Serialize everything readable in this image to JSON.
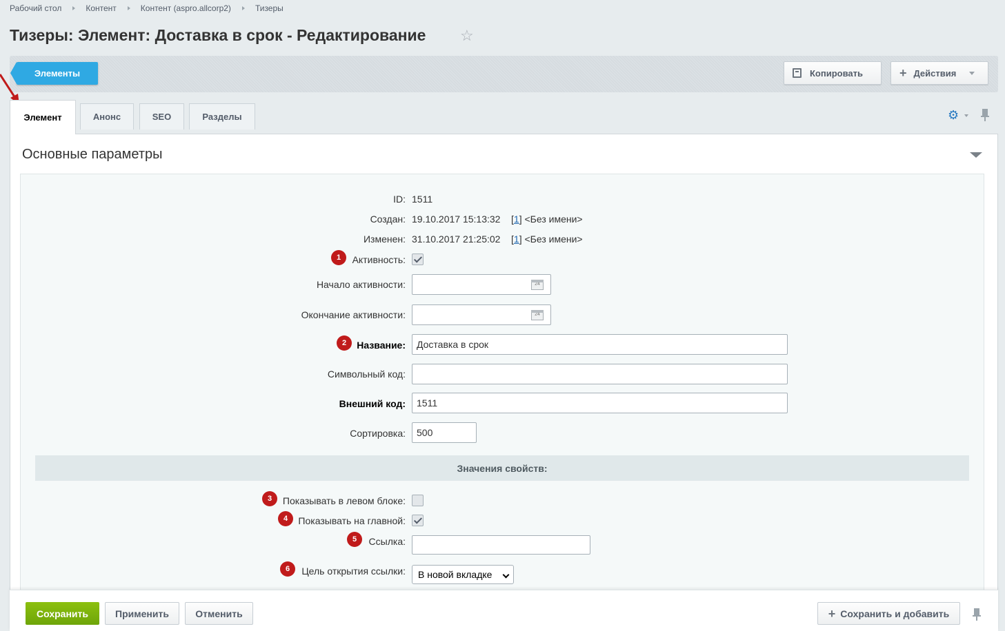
{
  "breadcrumb": [
    "Рабочий стол",
    "Контент",
    "Контент (aspro.allcorp2)",
    "Тизеры"
  ],
  "page_title": "Тизеры: Элемент: Доставка в срок - Редактирование",
  "toolbar": {
    "elements_label": "Элементы",
    "copy_label": "Копировать",
    "actions_label": "Действия"
  },
  "tabs": [
    {
      "label": "Элемент",
      "active": true
    },
    {
      "label": "Анонс",
      "active": false
    },
    {
      "label": "SEO",
      "active": false
    },
    {
      "label": "Разделы",
      "active": false
    }
  ],
  "section": {
    "title": "Основные параметры"
  },
  "form": {
    "id": {
      "label": "ID:",
      "value": "1511"
    },
    "created": {
      "label": "Создан:",
      "date": "19.10.2017 15:13:32",
      "user_link": "1",
      "user_name": "<Без имени>"
    },
    "modified": {
      "label": "Изменен:",
      "date": "31.10.2017 21:25:02",
      "user_link": "1",
      "user_name": "<Без имени>"
    },
    "active": {
      "badge": "1",
      "label": "Активность:",
      "checked": true
    },
    "active_from": {
      "label": "Начало активности:",
      "value": "",
      "calendar_text": "24"
    },
    "active_to": {
      "label": "Окончание активности:",
      "value": "",
      "calendar_text": "24"
    },
    "name": {
      "badge": "2",
      "label": "Название:",
      "value": "Доставка в срок"
    },
    "code": {
      "label": "Символьный код:",
      "value": ""
    },
    "xml_id": {
      "label": "Внешний код:",
      "value": "1511"
    },
    "sort": {
      "label": "Сортировка:",
      "value": "500"
    }
  },
  "properties": {
    "heading": "Значения свойств:",
    "show_left": {
      "badge": "3",
      "label": "Показывать в левом блоке:",
      "checked": false
    },
    "show_main": {
      "badge": "4",
      "label": "Показывать на главной:",
      "checked": true
    },
    "link": {
      "badge": "5",
      "label": "Ссылка:",
      "value": ""
    },
    "link_target": {
      "badge": "6",
      "label": "Цель открытия ссылки:",
      "selected": "В новой вкладке"
    }
  },
  "footer": {
    "save_label": "Сохранить",
    "apply_label": "Применить",
    "cancel_label": "Отменить",
    "save_add_label": "Сохранить и добавить"
  },
  "colors": {
    "accent_blue": "#2fa9e3",
    "save_green": "#7ab30c",
    "badge_red": "#c01b1b",
    "link_blue": "#2067b0"
  },
  "icons": [
    "star-icon",
    "copy-icon",
    "plus-icon",
    "gear-icon",
    "pin-icon",
    "calendar-icon",
    "chevron-down-icon",
    "red-arrow-annotation"
  ]
}
